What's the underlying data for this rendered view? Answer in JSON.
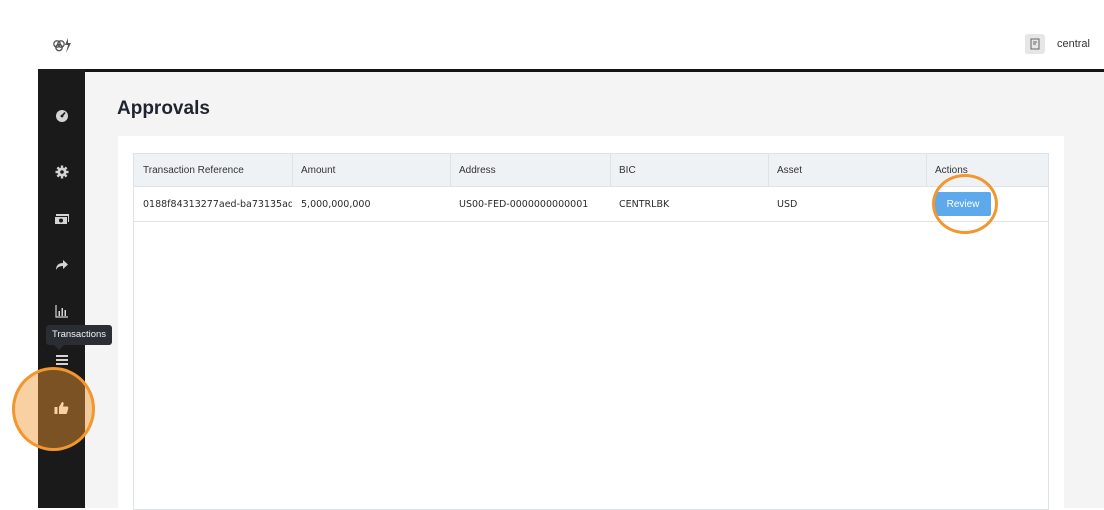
{
  "header": {
    "user_name": "central"
  },
  "icons": {
    "logo": "logo-icon",
    "user": "user-icon",
    "dashboard": "dashboard-icon",
    "settings": "gear-icon",
    "money": "money-icon",
    "transfer": "share-icon",
    "reports": "bar-chart-icon",
    "transactions": "list-icon",
    "approvals": "thumbs-up-icon"
  },
  "sidebar": {
    "tooltip": "Transactions"
  },
  "main": {
    "title": "Approvals",
    "table": {
      "headers": [
        "Transaction Reference",
        "Amount",
        "Address",
        "BIC",
        "Asset",
        "Actions"
      ],
      "rows": [
        {
          "reference": "0188f84313277aed-ba73135ad...",
          "amount": "5,000,000,000",
          "address": "US00-FED-0000000000001",
          "bic": "CENTRLBK",
          "asset": "USD",
          "action_label": "Review"
        }
      ]
    }
  },
  "colors": {
    "accent": "#5da9ec",
    "highlight": "#f2962f",
    "sidebar": "#1a1a1a"
  }
}
